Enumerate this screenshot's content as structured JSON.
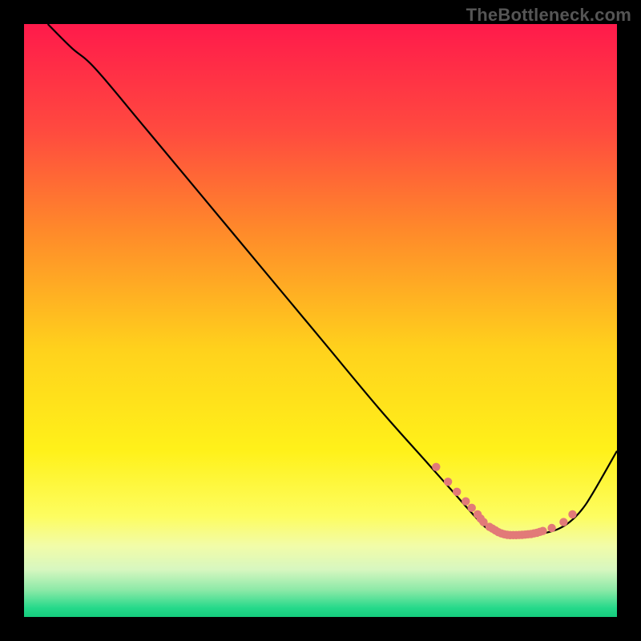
{
  "watermark": "TheBottleneck.com",
  "chart_data": {
    "type": "line",
    "title": "",
    "xlabel": "",
    "ylabel": "",
    "xlim": [
      0,
      100
    ],
    "ylim": [
      0,
      100
    ],
    "grid": false,
    "plot_background": "gradient",
    "curve": {
      "description": "Black bottleneck curve; starts at top-left, descends roughly linearly, flattens into a trough around x≈82, then rises toward the right edge.",
      "x": [
        4,
        8,
        12,
        20,
        30,
        40,
        50,
        60,
        68,
        72,
        76,
        78,
        80,
        82,
        84,
        86,
        88,
        90,
        92,
        94,
        96,
        100
      ],
      "y": [
        100,
        96,
        92.5,
        83,
        71,
        59,
        47,
        35,
        26,
        21.5,
        17,
        15,
        14,
        13.8,
        13.8,
        13.9,
        14.2,
        14.8,
        16,
        18,
        21,
        28
      ]
    },
    "markers": {
      "description": "Muted coral dots near the trough of the curve.",
      "color": "#e27a78",
      "points": [
        {
          "x": 69.5,
          "y": 25.3
        },
        {
          "x": 71.5,
          "y": 22.8
        },
        {
          "x": 73,
          "y": 21.1
        },
        {
          "x": 74.5,
          "y": 19.5
        },
        {
          "x": 75.5,
          "y": 18.4
        },
        {
          "x": 76.5,
          "y": 17.3
        },
        {
          "x": 77,
          "y": 16.6
        },
        {
          "x": 77.5,
          "y": 16.0
        },
        {
          "x": 78.5,
          "y": 15.2
        },
        {
          "x": 79,
          "y": 14.9
        },
        {
          "x": 79.5,
          "y": 14.6
        },
        {
          "x": 80,
          "y": 14.3
        },
        {
          "x": 80.5,
          "y": 14.1
        },
        {
          "x": 81,
          "y": 13.95
        },
        {
          "x": 81.5,
          "y": 13.85
        },
        {
          "x": 82,
          "y": 13.8
        },
        {
          "x": 82.5,
          "y": 13.8
        },
        {
          "x": 83,
          "y": 13.8
        },
        {
          "x": 83.5,
          "y": 13.82
        },
        {
          "x": 84,
          "y": 13.85
        },
        {
          "x": 84.5,
          "y": 13.9
        },
        {
          "x": 85,
          "y": 13.95
        },
        {
          "x": 85.5,
          "y": 14.0
        },
        {
          "x": 86,
          "y": 14.1
        },
        {
          "x": 86.5,
          "y": 14.2
        },
        {
          "x": 87,
          "y": 14.35
        },
        {
          "x": 87.5,
          "y": 14.5
        },
        {
          "x": 89,
          "y": 15.0
        },
        {
          "x": 91,
          "y": 16.0
        },
        {
          "x": 92.5,
          "y": 17.3
        }
      ]
    },
    "gradient_stops": [
      {
        "offset": 0.0,
        "color": "#ff1a4b"
      },
      {
        "offset": 0.18,
        "color": "#ff4a3f"
      },
      {
        "offset": 0.35,
        "color": "#ff8a2a"
      },
      {
        "offset": 0.55,
        "color": "#ffd21c"
      },
      {
        "offset": 0.72,
        "color": "#fff11a"
      },
      {
        "offset": 0.83,
        "color": "#fdfd60"
      },
      {
        "offset": 0.88,
        "color": "#f2fca8"
      },
      {
        "offset": 0.92,
        "color": "#d7f7c0"
      },
      {
        "offset": 0.955,
        "color": "#8be9a7"
      },
      {
        "offset": 0.985,
        "color": "#25d98a"
      },
      {
        "offset": 1.0,
        "color": "#15cc7d"
      }
    ]
  }
}
